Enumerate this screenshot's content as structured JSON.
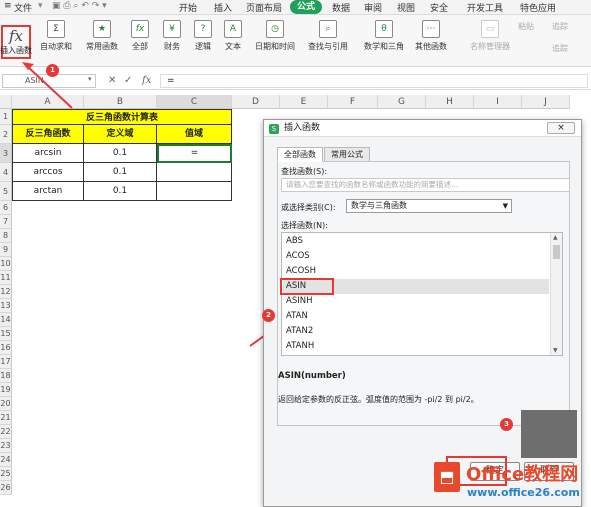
{
  "menu": {
    "items": [
      "文件",
      "开始",
      "插入",
      "页面布局",
      "公式",
      "数据",
      "审阅",
      "视图",
      "安全",
      "开发工具",
      "特色应用"
    ],
    "active": "公式"
  },
  "ribbon": {
    "insert_function": "插入函数",
    "autosum": "自动求和",
    "common": "常用函数",
    "all": "全部",
    "finance": "财务",
    "logic": "逻辑",
    "text": "文本",
    "datetime": "日期和时间",
    "lookup": "查找与引用",
    "math": "数学和三角",
    "other": "其他函数",
    "name_manager": "名称管理器",
    "paste": "粘贴",
    "trace_precedents": "追踪",
    "trace_dependents": "追踪"
  },
  "formula_bar": {
    "name_box": "ASIN",
    "value": "="
  },
  "sheet": {
    "columns": [
      "A",
      "B",
      "C",
      "D",
      "E",
      "F",
      "G",
      "H",
      "I",
      "J"
    ],
    "rows": [
      "1",
      "2",
      "3",
      "4",
      "5",
      "6",
      "7",
      "8",
      "9",
      "10",
      "11",
      "12",
      "13",
      "14",
      "15",
      "16",
      "17",
      "18",
      "19",
      "20",
      "21",
      "22",
      "23",
      "24",
      "25",
      "26"
    ],
    "table_title": "反三角函数计算表",
    "headers": [
      "反三角函数",
      "定义域",
      "值域"
    ],
    "data": [
      [
        "arcsin",
        "0.1",
        "="
      ],
      [
        "arccos",
        "0.1",
        ""
      ],
      [
        "arctan",
        "0.1",
        ""
      ]
    ]
  },
  "dialog": {
    "title": "插入函数",
    "close": "×",
    "tabs": [
      "全部函数",
      "常用公式"
    ],
    "search_label": "查找函数(S):",
    "search_placeholder": "请输入您要查找的函数名称或函数功能的简要描述...",
    "category_label": "或选择类别(C):",
    "category_value": "数学与三角函数",
    "select_label": "选择函数(N):",
    "functions": [
      "ABS",
      "ACOS",
      "ACOSH",
      "ASIN",
      "ASINH",
      "ATAN",
      "ATAN2",
      "ATANH"
    ],
    "selected": "ASIN",
    "signature": "ASIN(number)",
    "description": "返回给定参数的反正弦。弧度值的范围为 -pi/2 到 pi/2。",
    "ok": "确定",
    "cancel": "取消"
  },
  "annotations": {
    "badges": [
      "1",
      "2",
      "3"
    ],
    "accent": "#e53935"
  },
  "watermark": {
    "brand": "Office教程网",
    "url": "www.office26.com"
  }
}
